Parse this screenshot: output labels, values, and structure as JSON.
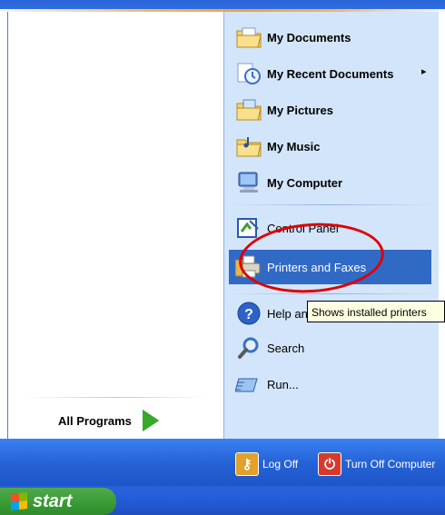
{
  "start_menu": {
    "places": [
      {
        "label": "My Documents",
        "icon": "folder-documents-icon",
        "bold": true
      },
      {
        "label": "My Recent Documents",
        "icon": "recent-documents-icon",
        "bold": true,
        "submenu": "▸"
      },
      {
        "label": "My Pictures",
        "icon": "folder-pictures-icon",
        "bold": true
      },
      {
        "label": "My Music",
        "icon": "folder-music-icon",
        "bold": true
      },
      {
        "label": "My Computer",
        "icon": "computer-icon",
        "bold": true
      }
    ],
    "tools": [
      {
        "label": "Control Panel",
        "icon": "control-panel-icon"
      },
      {
        "label": "Printers and Faxes",
        "icon": "printer-icon",
        "highlighted": true
      }
    ],
    "misc": [
      {
        "label": "Help and Support",
        "visible_label": "Help and",
        "icon": "help-icon"
      },
      {
        "label": "Search",
        "icon": "search-icon"
      },
      {
        "label": "Run...",
        "icon": "run-icon"
      }
    ],
    "tooltip": "Shows installed printers",
    "all_programs": "All Programs",
    "log_off": "Log Off",
    "turn_off": "Turn Off Computer"
  },
  "taskbar": {
    "start_label": "start"
  },
  "colors": {
    "menu_blue": "#2563d6",
    "right_pane": "#d3e5fa",
    "highlight": "#316ac5",
    "start_green": "#3c9d37",
    "annotation_red": "#e00000"
  }
}
